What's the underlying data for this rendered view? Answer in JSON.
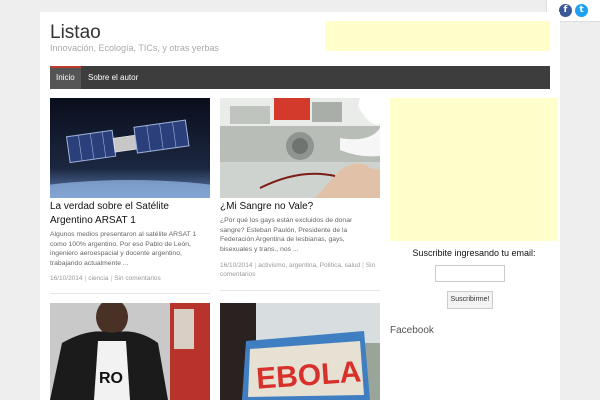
{
  "site": {
    "title": "Listao",
    "description": "Innovación, Ecología, TICs, y otras yerbas"
  },
  "nav": {
    "items": [
      {
        "label": "Inicio",
        "active": true
      },
      {
        "label": "Sobre el autor",
        "active": false
      }
    ]
  },
  "posts": [
    {
      "title": "La verdad sobre el Satélite Argentino ARSAT 1",
      "excerpt": "Algunos medios presentaron al satélite ARSAT 1 como 100% argentino. Por eso Pablo de León, ingeniero aeroespacial y docente argentino, trabajando actualmente ...",
      "date": "16/10/2014",
      "categories": "ciencia",
      "comments": "Sin comentarios",
      "image": "satellite"
    },
    {
      "title": "¿Mi Sangre no Vale?",
      "excerpt": "¿Por qué los gays están excluidos de donar sangre? Esteban Paulón, Presidente de la Federación Argentina de lesbianas, gays, bisexuales y trans., nos ...",
      "date": "16/10/2014",
      "categories": "activismo, argentina, Política, salud",
      "comments": "Sin comentarios",
      "image": "blood-donation"
    },
    {
      "image": "person-jacket",
      "image_text": "RO"
    },
    {
      "image": "ebola-sign",
      "image_text": "EBOLA"
    }
  ],
  "sidebar": {
    "subscribe_title": "Suscribite ingresando tu email:",
    "subscribe_input_value": "",
    "subscribe_button": "Suscribirme!",
    "facebook_title": "Facebook"
  },
  "social": {
    "icons": [
      "facebook-icon",
      "twitter-icon"
    ],
    "colors": {
      "facebook": "#3b5998",
      "twitter": "#1da1f2"
    }
  },
  "colors": {
    "nav_bg": "#3d3d3d",
    "nav_active_accent": "#c0392b",
    "ad_placeholder": "#ffffcc"
  }
}
